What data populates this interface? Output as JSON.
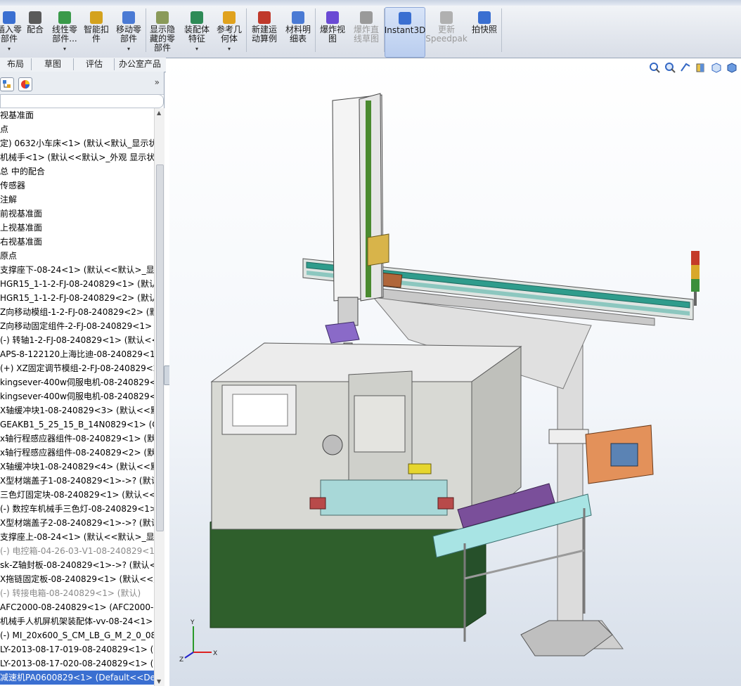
{
  "ribbon": {
    "buttons": [
      {
        "id": "insert",
        "label": "插入零\n部件",
        "arrow": true
      },
      {
        "id": "mate",
        "label": "配合",
        "arrow": false
      },
      {
        "id": "linear",
        "label": "线性零\n部件...",
        "arrow": true
      },
      {
        "id": "smart",
        "label": "智能扣\n件",
        "arrow": false
      },
      {
        "id": "move",
        "label": "移动零\n部件",
        "arrow": true
      },
      {
        "id": "showhide",
        "label": "显示隐\n藏的零\n部件",
        "arrow": false
      },
      {
        "id": "asmfeat",
        "label": "装配体\n特征",
        "arrow": true
      },
      {
        "id": "refgeom",
        "label": "参考几\n何体",
        "arrow": true
      },
      {
        "id": "motion",
        "label": "新建运\n动算例",
        "arrow": false
      },
      {
        "id": "bom",
        "label": "材料明\n细表",
        "arrow": false
      },
      {
        "id": "explode",
        "label": "爆炸视\n图",
        "arrow": false
      },
      {
        "id": "explodeline",
        "label": "爆炸直\n线草图",
        "arrow": false
      },
      {
        "id": "instant3d",
        "label": "Instant3D",
        "arrow": false
      },
      {
        "id": "speedpak",
        "label": "更新\nSpeedpak",
        "arrow": false
      },
      {
        "id": "snapshot",
        "label": "拍快照",
        "arrow": false
      }
    ]
  },
  "command_tabs": [
    "布局",
    "草图",
    "评估",
    "办公室产品"
  ],
  "tree": {
    "rows": [
      {
        "text": "视基准面"
      },
      {
        "text": "点"
      },
      {
        "text": "定) 0632小车床<1> (默认<默认_显示状态"
      },
      {
        "text": "机械手<1> (默认<<默认>_外观 显示状态"
      },
      {
        "text": "总 中的配合"
      },
      {
        "text": "传感器"
      },
      {
        "text": "注解"
      },
      {
        "text": "前视基准面"
      },
      {
        "text": "上视基准面"
      },
      {
        "text": "右视基准面"
      },
      {
        "text": "原点"
      },
      {
        "text": "支撑座下-08-24<1> (默认<<默认>_显示"
      },
      {
        "text": "HGR15_1-1-2-FJ-08-240829<1> (默认<"
      },
      {
        "text": "HGR15_1-1-2-FJ-08-240829<2> (默认<"
      },
      {
        "text": "Z向移动模组-1-2-FJ-08-240829<2> (默"
      },
      {
        "text": "Z向移动固定组件-2-FJ-08-240829<1> (≡"
      },
      {
        "text": "(-) 转轴1-2-FJ-08-240829<1> (默认<<"
      },
      {
        "text": "APS-8-122120上海比迪-08-240829<1>"
      },
      {
        "text": "(+) XZ固定调节模组-2-FJ-08-240829<2"
      },
      {
        "text": "kingsever-400w伺服电机-08-240829<1"
      },
      {
        "text": "kingsever-400w伺服电机-08-240829<2"
      },
      {
        "text": "X轴缓冲块1-08-240829<3> (默认<<默"
      },
      {
        "text": "GEAKB1_5_25_15_B_14N0829<1> (GE"
      },
      {
        "text": "x轴行程感应器组件-08-240829<1> (默认"
      },
      {
        "text": "x轴行程感应器组件-08-240829<2> (默认"
      },
      {
        "text": "X轴缓冲块1-08-240829<4> (默认<<默"
      },
      {
        "text": "X型材端盖子1-08-240829<1>->? (默认"
      },
      {
        "text": "三色灯固定块-08-240829<1> (默认<<默"
      },
      {
        "text": "(-) 数控车机械手三色灯-08-240829<1>"
      },
      {
        "text": "X型材端盖子2-08-240829<1>->? (默认"
      },
      {
        "text": "支撑座上-08-24<1> (默认<<默认>_显示"
      },
      {
        "text": "(-) 电控箱-04-26-03-V1-08-240829<1>",
        "muted": true
      },
      {
        "text": "sk-Z轴封板-08-240829<1>->? (默认<<"
      },
      {
        "text": "X拖链固定板-08-240829<1> (默认<<默"
      },
      {
        "text": "(-) 转接电箱-08-240829<1> (默认)",
        "muted": true
      },
      {
        "text": "AFC2000-08-240829<1> (AFC2000-P<"
      },
      {
        "text": "机械手人机屏机架装配体-vv-08-24<1> ("
      },
      {
        "text": "(-) MI_20x600_S_CM_LB_G_M_2_0_082!"
      },
      {
        "text": "LY-2013-08-17-019-08-240829<1> (D"
      },
      {
        "text": "LY-2013-08-17-020-08-240829<1> (D"
      },
      {
        "text": "减速机PA0600829<1> (Default<<Defa",
        "selected": true
      }
    ]
  },
  "colors": {
    "accent": "#3a6fd1",
    "machine_gray": "#d8d9d4",
    "base_green": "#2f5f2c",
    "tray_teal": "#a8e4e4",
    "parts_purple": "#7a4f9a",
    "rail_teal": "#2f9c8c"
  },
  "triad": {
    "x": "X",
    "y": "Y",
    "z": "Z"
  }
}
